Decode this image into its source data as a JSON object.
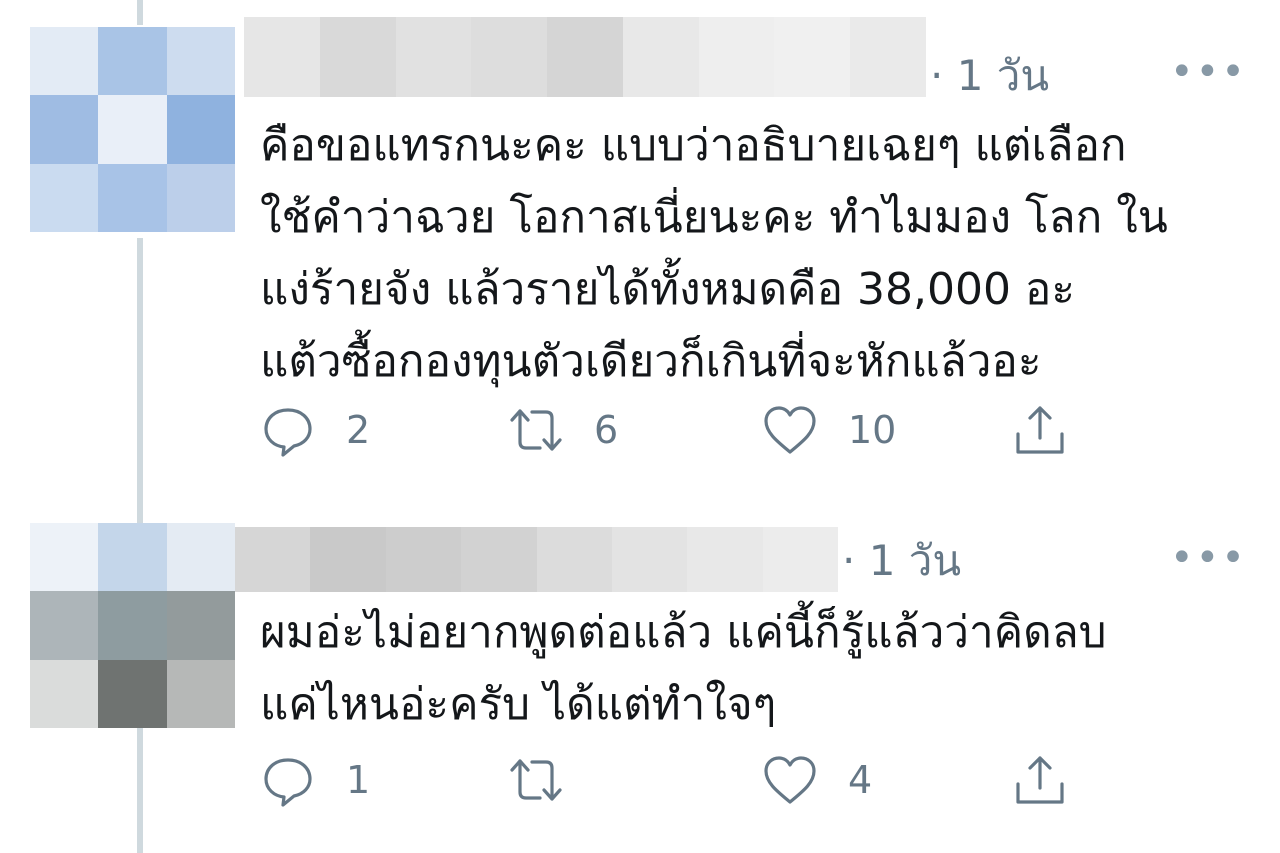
{
  "tweets": [
    {
      "time": "· 1 วัน",
      "more": "•••",
      "lines": [
        "คือขอแทรกนะคะ แบบว่าอธิบายเฉยๆ แต่เลือก",
        "ใช้คำว่าฉวย โอกาสเนี่ยนะคะ ทำไมมอง โลก ใน",
        "แง่ร้ายจัง แล้วรายได้ทั้งหมดคือ 38,000 อะ",
        "แต้วซื้อกองทุนตัวเดียวก็เกินที่จะหักแล้วอะ"
      ],
      "replies": "2",
      "retweets": "6",
      "likes": "10",
      "avatar_colors": [
        "#e3ebf5",
        "#a9c4e6",
        "#cddcef",
        "#9fbce3",
        "#e9eff8",
        "#8fb2df",
        "#cadbf0",
        "#a8c3e7",
        "#bccfea"
      ],
      "name_blur_colors": [
        "#e6e6e6",
        "#d9d9d9",
        "#e1e1e1",
        "#dddddd",
        "#d5d5d5",
        "#e8e8e8",
        "#eeeeee",
        "#f0f0f0",
        "#eaeaea"
      ]
    },
    {
      "time": "· 1 วัน",
      "more": "•••",
      "lines": [
        "ผมอ่ะไม่อยากพูดต่อแล้ว แค่นี้ก็รู้แล้วว่าคิดลบ",
        "แค่ไหนอ่ะครับ ได้แต่ทำใจๆ"
      ],
      "replies": "1",
      "retweets": "",
      "likes": "4",
      "avatar_colors": [
        "#edf2f8",
        "#c4d6ea",
        "#e4ebf3",
        "#adb5b9",
        "#8e9ca0",
        "#939b9c",
        "#dadcdb",
        "#6f7371",
        "#b6b8b7"
      ],
      "name_blur_colors": [
        "#d6d6d6",
        "#c9c9c9",
        "#cdcdcd",
        "#d2d2d2",
        "#dcdcdc",
        "#e3e3e3",
        "#e8e8e8",
        "#ececec"
      ]
    }
  ],
  "icons": {
    "reply": "reply-icon",
    "retweet": "retweet-icon",
    "like": "like-icon",
    "share": "share-icon"
  }
}
